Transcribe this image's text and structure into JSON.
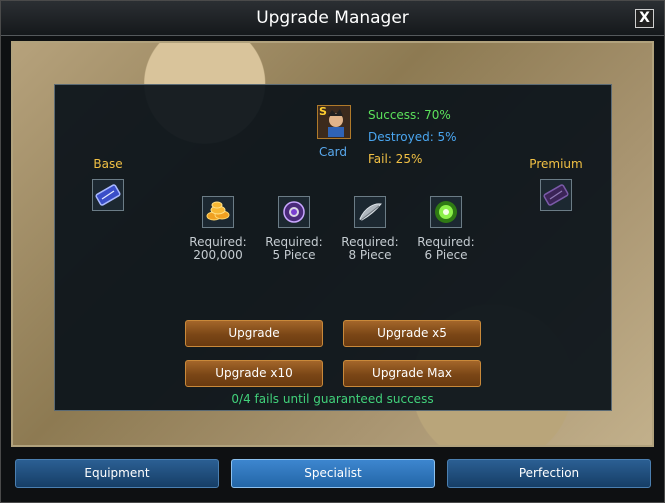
{
  "window": {
    "title": "Upgrade Manager",
    "close_label": "X"
  },
  "base": {
    "label": "Base"
  },
  "premium": {
    "label": "Premium"
  },
  "card": {
    "badge": "S",
    "label": "Card"
  },
  "rates": {
    "success": "Success: 70%",
    "destroyed": "Destroyed: 5%",
    "fail": "Fail: 25%",
    "colors": {
      "success": "#5be15b",
      "destroyed": "#4aa6f0",
      "fail": "#f1c044"
    }
  },
  "requirements": [
    {
      "icon": "gold-coins-icon",
      "line1": "Required:",
      "line2": "200,000"
    },
    {
      "icon": "purple-orb-icon",
      "line1": "Required:",
      "line2": "5 Piece"
    },
    {
      "icon": "feather-icon",
      "line1": "Required:",
      "line2": "8 Piece"
    },
    {
      "icon": "green-glow-icon",
      "line1": "Required:",
      "line2": "6 Piece"
    }
  ],
  "buttons": {
    "upgrade": "Upgrade",
    "upgrade_x5": "Upgrade x5",
    "upgrade_x10": "Upgrade x10",
    "upgrade_max": "Upgrade Max"
  },
  "guarantee_text": "0/4 fails until guaranteed success",
  "tabs": [
    {
      "label": "Equipment",
      "active": false
    },
    {
      "label": "Specialist",
      "active": true
    },
    {
      "label": "Perfection",
      "active": false
    }
  ],
  "colors": {
    "accent_gold": "#f1c044",
    "guarantee_green": "#41d17a",
    "tab_blue": "#2366a7"
  }
}
